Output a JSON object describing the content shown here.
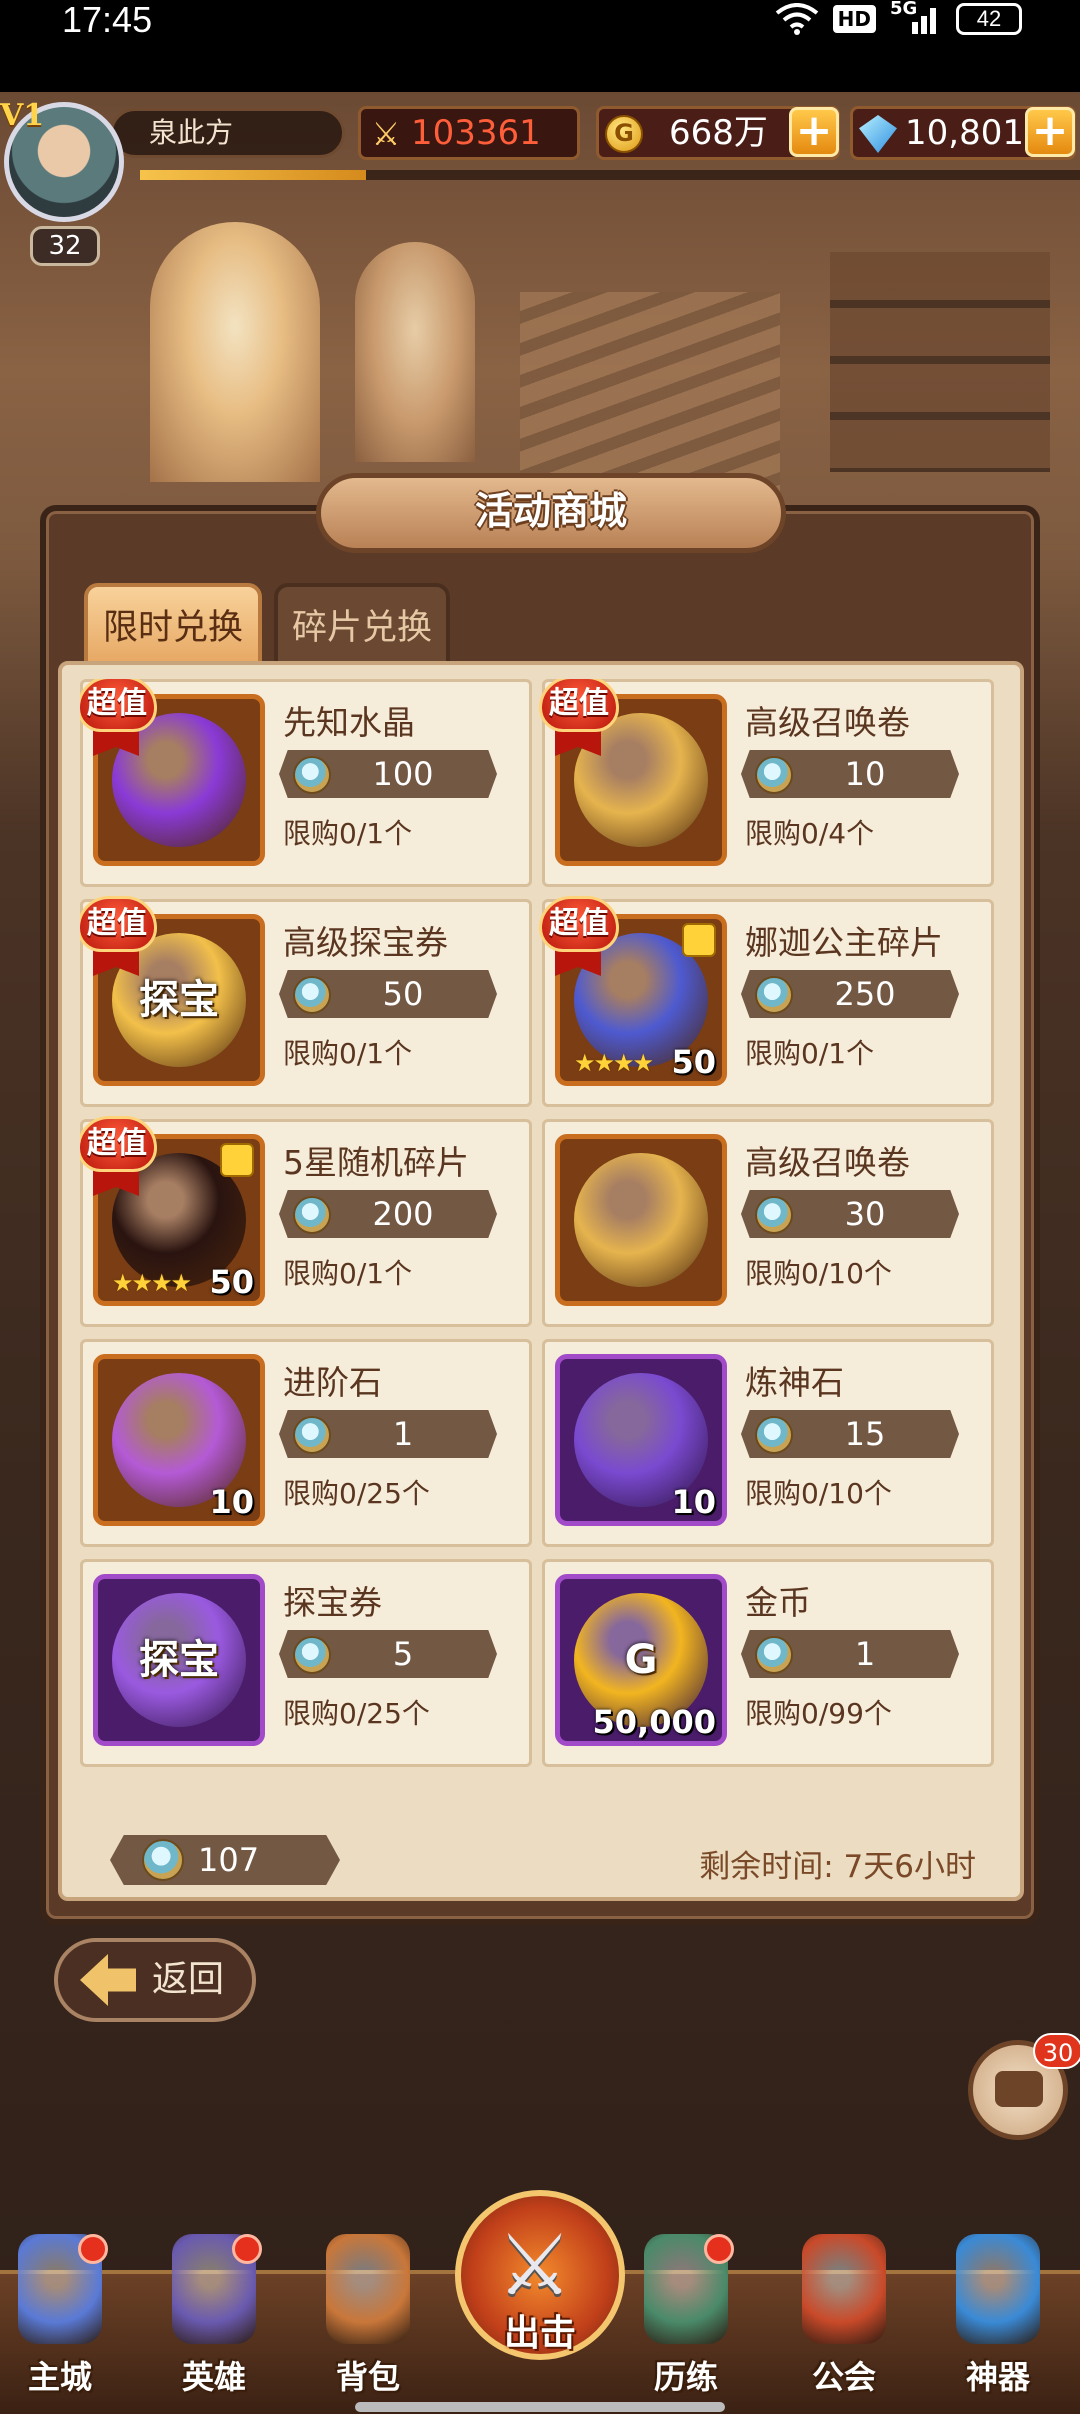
{
  "status_bar": {
    "time": "17:45",
    "hd": "HD",
    "network": "5G",
    "battery": "42",
    "icons": [
      "wifi-icon",
      "signal-icon",
      "battery-icon"
    ]
  },
  "hud": {
    "vip": "V1",
    "player_name": "泉此方",
    "level": "32",
    "combat_power": "103361",
    "gold": "668万",
    "gold_icon": "G",
    "gems": "10,801",
    "plus": "+",
    "xp_progress": 0.24
  },
  "panel": {
    "title": "活动商城",
    "tabs": [
      {
        "label": "限时兑换",
        "active": true
      },
      {
        "label": "碎片兑换",
        "active": false
      }
    ]
  },
  "ribbon_label": "超值",
  "items": [
    {
      "name": "先知水晶",
      "price": "100",
      "limit": "限购0/1个",
      "hot": true,
      "frame": "orange",
      "qty": "",
      "stars": "",
      "icon": "crystal-orb-icon",
      "color": "#8a3ad6"
    },
    {
      "name": "高级召唤卷",
      "price": "10",
      "limit": "限购0/4个",
      "hot": true,
      "frame": "orange",
      "qty": "",
      "stars": "",
      "icon": "scroll-icon",
      "color": "#e6b44e"
    },
    {
      "name": "高级探宝券",
      "price": "50",
      "limit": "限购0/1个",
      "hot": true,
      "frame": "orange",
      "qty": "",
      "stars": "",
      "icon": "treasure-ticket-icon",
      "color": "#f2c04a",
      "art_text": "探宝"
    },
    {
      "name": "娜迦公主碎片",
      "price": "250",
      "limit": "限购0/1个",
      "hot": true,
      "frame": "orange",
      "qty": "50",
      "stars": "★★★★",
      "icon": "naga-princess-portrait-icon",
      "color": "#4e5ad0"
    },
    {
      "name": "5星随机碎片",
      "price": "200",
      "limit": "限购0/1个",
      "hot": true,
      "frame": "orange",
      "qty": "50",
      "stars": "★★★★",
      "icon": "random-shard-icon",
      "color": "#2a1410"
    },
    {
      "name": "高级召唤卷",
      "price": "30",
      "limit": "限购0/10个",
      "hot": false,
      "frame": "orange",
      "qty": "",
      "stars": "",
      "icon": "scroll-icon",
      "color": "#e6b44e"
    },
    {
      "name": "进阶石",
      "price": "1",
      "limit": "限购0/25个",
      "hot": false,
      "frame": "orange",
      "qty": "10",
      "stars": "",
      "icon": "advance-stone-icon",
      "color": "#b45ad6"
    },
    {
      "name": "炼神石",
      "price": "15",
      "limit": "限购0/10个",
      "hot": false,
      "frame": "purple",
      "qty": "10",
      "stars": "",
      "icon": "refine-stone-icon",
      "color": "#7a4ad0"
    },
    {
      "name": "探宝券",
      "price": "5",
      "limit": "限购0/25个",
      "hot": false,
      "frame": "purple",
      "qty": "",
      "stars": "",
      "icon": "treasure-ticket-icon",
      "color": "#9a5ae0",
      "art_text": "探宝"
    },
    {
      "name": "金币",
      "price": "1",
      "limit": "限购0/99个",
      "hot": false,
      "frame": "purple",
      "qty": "50,000",
      "stars": "",
      "icon": "gold-coin-icon",
      "color": "#f2b520",
      "art_text": "G"
    }
  ],
  "footer": {
    "currency_amount": "107",
    "time_left": "剩余时间: 7天6小时"
  },
  "back_label": "返回",
  "chat_badge": "30",
  "nav": {
    "items": [
      {
        "label": "主城",
        "icon": "castle-icon",
        "dot": true,
        "color": "#5a7ad6"
      },
      {
        "label": "英雄",
        "icon": "helmet-icon",
        "dot": true,
        "color": "#6a5ab0"
      },
      {
        "label": "背包",
        "icon": "backpack-icon",
        "dot": false,
        "color": "#c9773a"
      },
      {
        "label": "历练",
        "icon": "training-orb-icon",
        "dot": true,
        "color": "#4a8a6a"
      },
      {
        "label": "公会",
        "icon": "guild-banner-icon",
        "dot": false,
        "color": "#c94a2a"
      },
      {
        "label": "神器",
        "icon": "artifact-globe-icon",
        "dot": false,
        "color": "#3a8ad6"
      }
    ],
    "center_label": "出击",
    "center_icon": "crossed-swords-icon"
  }
}
